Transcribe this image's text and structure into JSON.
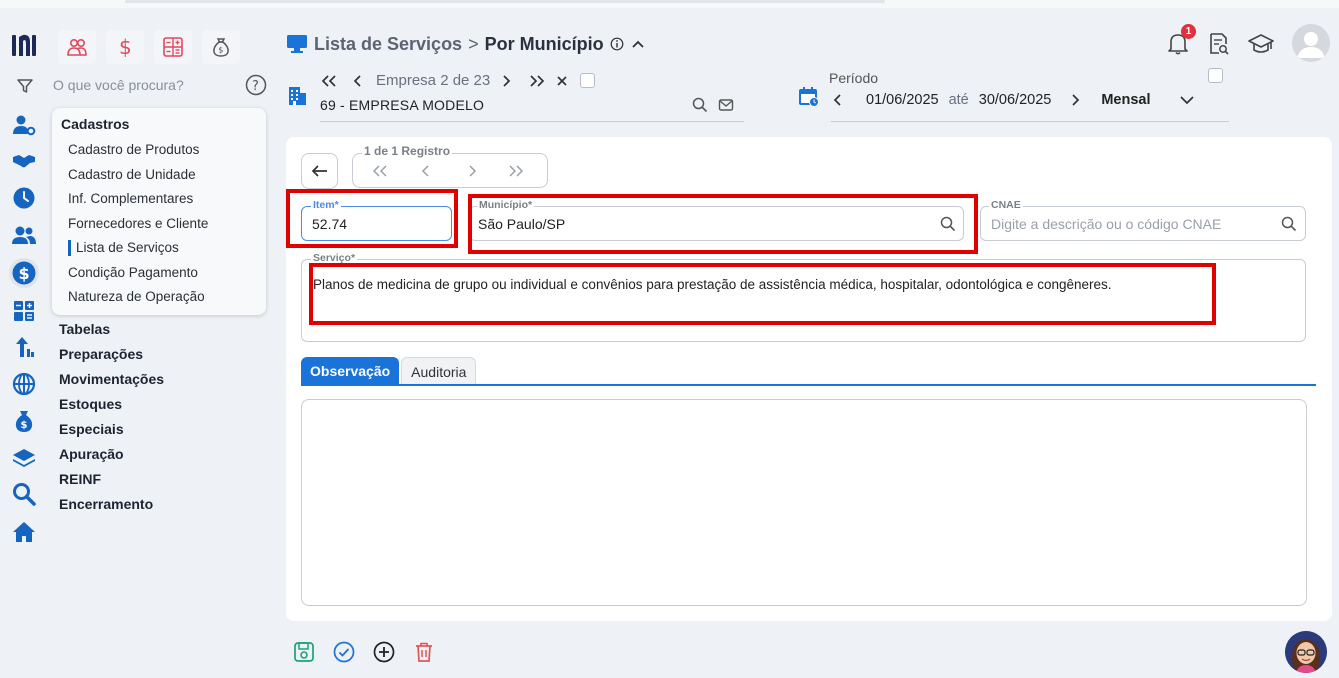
{
  "sidebar": {
    "search_placeholder": "O que você procura?",
    "submenu": {
      "title": "Cadastros",
      "items": [
        "Cadastro de Produtos",
        "Cadastro de Unidade",
        "Inf. Complementares",
        "Fornecedores e Cliente",
        "Lista de Serviços",
        "Condição Pagamento",
        "Natureza de Operação"
      ],
      "active_item": "Lista de Serviços"
    },
    "menu": [
      "Tabelas",
      "Preparações",
      "Movimentações",
      "Estoques",
      "Especiais",
      "Apuração",
      "REINF",
      "Encerramento"
    ]
  },
  "header": {
    "breadcrumb_parent": "Lista de Serviços",
    "breadcrumb_separator": ">",
    "breadcrumb_current": "Por Município",
    "notification_count": "1"
  },
  "empresa": {
    "nav_text": "Empresa 2 de 23",
    "name": "69 - EMPRESA MODELO"
  },
  "periodo": {
    "label": "Período",
    "start": "01/06/2025",
    "connector": "até",
    "end": "30/06/2025",
    "mode": "Mensal"
  },
  "record": {
    "label": "1 de 1 Registro"
  },
  "form": {
    "item_label": "Item*",
    "item_value": "52.74",
    "municipio_label": "Município*",
    "municipio_value": "São Paulo/SP",
    "cnae_label": "CNAE",
    "cnae_placeholder": "Digite a descrição ou o código CNAE",
    "servico_label": "Serviço*",
    "servico_value": "Planos de medicina de grupo ou individual e convênios para prestação de assistência médica, hospitalar, odontológica e congêneres."
  },
  "tabs": [
    {
      "label": "Observação",
      "active": true
    },
    {
      "label": "Auditoria",
      "active": false
    }
  ],
  "colors": {
    "accent": "#1a73d9",
    "highlight": "#e00000",
    "save": "#1aa37a",
    "delete": "#e05555"
  }
}
